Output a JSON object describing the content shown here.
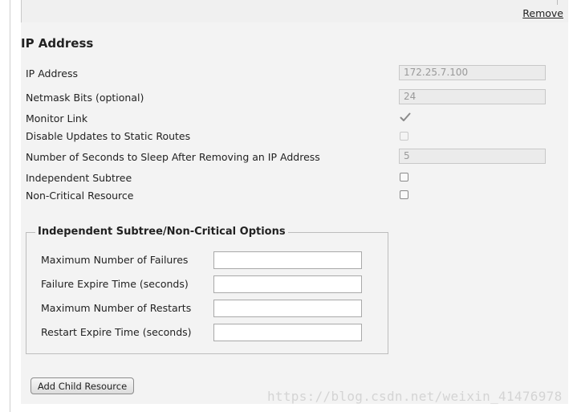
{
  "top_block": {
    "remove_label": "Remove"
  },
  "section": {
    "title": "IP Address"
  },
  "fields": {
    "ip_address": {
      "label": "IP Address",
      "value": "172.25.7.100"
    },
    "netmask": {
      "label": "Netmask Bits (optional)",
      "value": "24"
    },
    "monitor_link": {
      "label": "Monitor Link",
      "checked": true,
      "disabled": true
    },
    "disable_updates": {
      "label": "Disable Updates to Static Routes",
      "checked": false,
      "disabled": true
    },
    "sleep_seconds": {
      "label": "Number of Seconds to Sleep After Removing an IP Address",
      "value": "5"
    },
    "independent_subtree": {
      "label": "Independent Subtree",
      "checked": false
    },
    "non_critical": {
      "label": "Non-Critical Resource",
      "checked": false
    }
  },
  "options": {
    "legend": "Independent Subtree/Non-Critical Options",
    "max_failures": {
      "label": "Maximum Number of Failures",
      "value": ""
    },
    "failure_expire": {
      "label": "Failure Expire Time (seconds)",
      "value": ""
    },
    "max_restarts": {
      "label": "Maximum Number of Restarts",
      "value": ""
    },
    "restart_expire": {
      "label": "Restart Expire Time (seconds)",
      "value": ""
    }
  },
  "actions": {
    "add_child_label": "Add Child Resource"
  },
  "watermark": "https://blog.csdn.net/weixin_41476978",
  "colors": {
    "panel_bg": "#f3f3f3",
    "disabled_input_bg": "#ebebeb",
    "disabled_text": "#999999"
  }
}
